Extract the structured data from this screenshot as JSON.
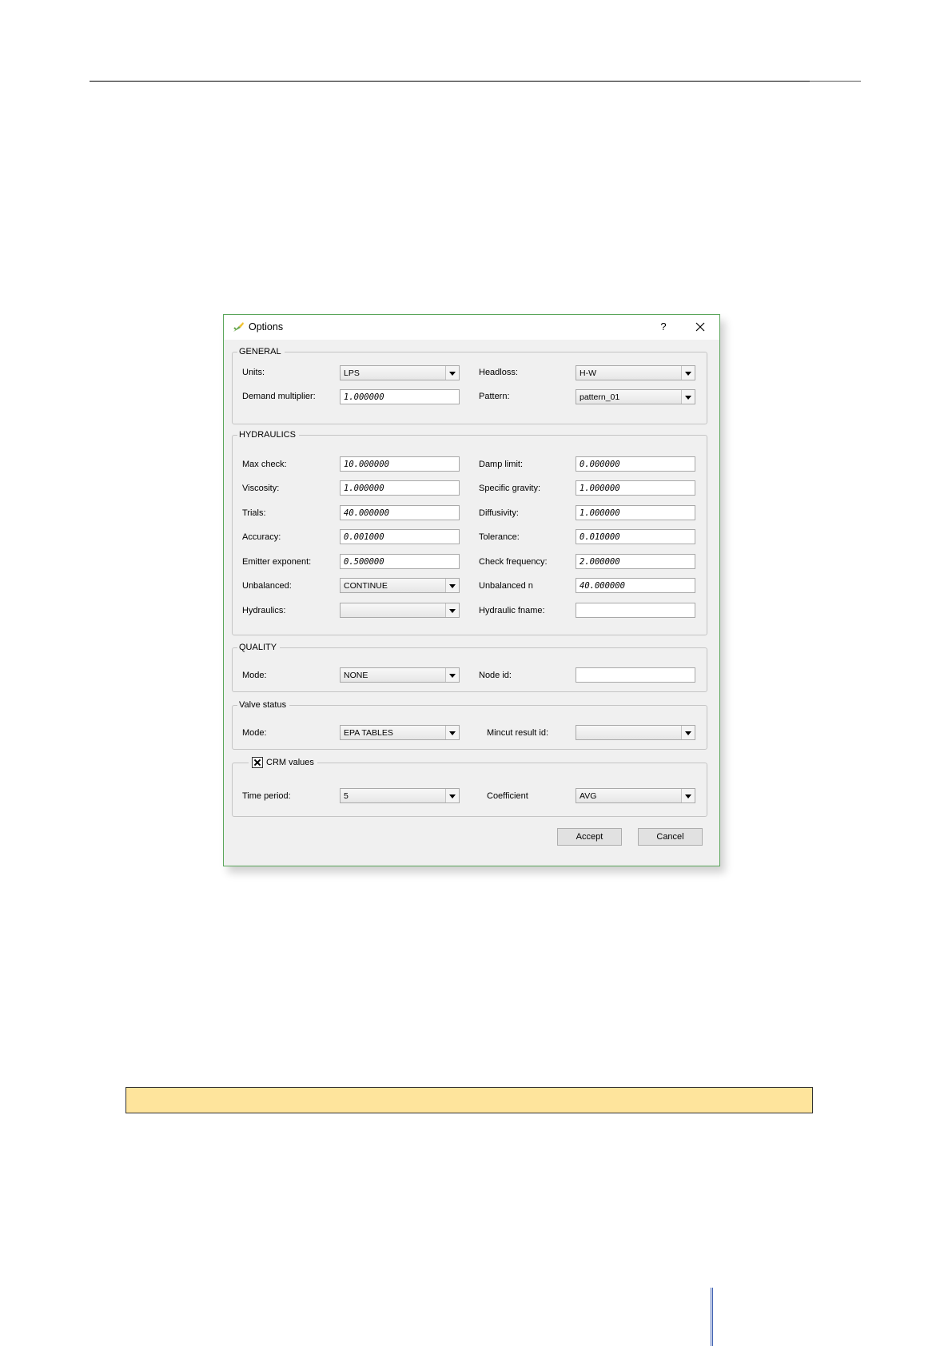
{
  "dialog": {
    "title": "Options",
    "help_label": "?",
    "general": {
      "title": "GENERAL",
      "units_label": "Units:",
      "units_value": "LPS",
      "headloss_label": "Headloss:",
      "headloss_value": "H-W",
      "demand_multiplier_label": "Demand multiplier:",
      "demand_multiplier_value": "1.000000",
      "pattern_label": "Pattern:",
      "pattern_value": "pattern_01"
    },
    "hydraulics": {
      "title": "HYDRAULICS",
      "max_check_label": "Max check:",
      "max_check_value": "10.000000",
      "damp_limit_label": "Damp limit:",
      "damp_limit_value": "0.000000",
      "viscosity_label": "Viscosity:",
      "viscosity_value": "1.000000",
      "specific_gravity_label": "Specific gravity:",
      "specific_gravity_value": "1.000000",
      "trials_label": "Trials:",
      "trials_value": "40.000000",
      "diffusivity_label": "Diffusivity:",
      "diffusivity_value": "1.000000",
      "accuracy_label": "Accuracy:",
      "accuracy_value": "0.001000",
      "tolerance_label": "Tolerance:",
      "tolerance_value": "0.010000",
      "emitter_exponent_label": "Emitter exponent:",
      "emitter_exponent_value": "0.500000",
      "check_frequency_label": "Check frequency:",
      "check_frequency_value": "2.000000",
      "unbalanced_label": "Unbalanced:",
      "unbalanced_value": "CONTINUE",
      "unbalanced_n_label": "Unbalanced n",
      "unbalanced_n_value": "40.000000",
      "hydraulics_label": "Hydraulics:",
      "hydraulics_value": "",
      "hydraulic_fname_label": "Hydraulic fname:",
      "hydraulic_fname_value": ""
    },
    "quality": {
      "title": "QUALITY",
      "mode_label": "Mode:",
      "mode_value": "NONE",
      "node_id_label": "Node id:",
      "node_id_value": ""
    },
    "valve_status": {
      "title": "Valve status",
      "mode_label": "Mode:",
      "mode_value": "EPA TABLES",
      "mincut_label": "Mincut result id:",
      "mincut_value": ""
    },
    "crm": {
      "checkbox_label": "CRM values",
      "checked": true,
      "time_period_label": "Time period:",
      "time_period_value": "5",
      "coefficient_label": "Coefficient",
      "coefficient_value": "AVG"
    },
    "buttons": {
      "accept": "Accept",
      "cancel": "Cancel"
    },
    "colors": {
      "border": "#5aa55a",
      "note_bar": "#fee49c",
      "side_rule": "#3b5eb0"
    }
  }
}
